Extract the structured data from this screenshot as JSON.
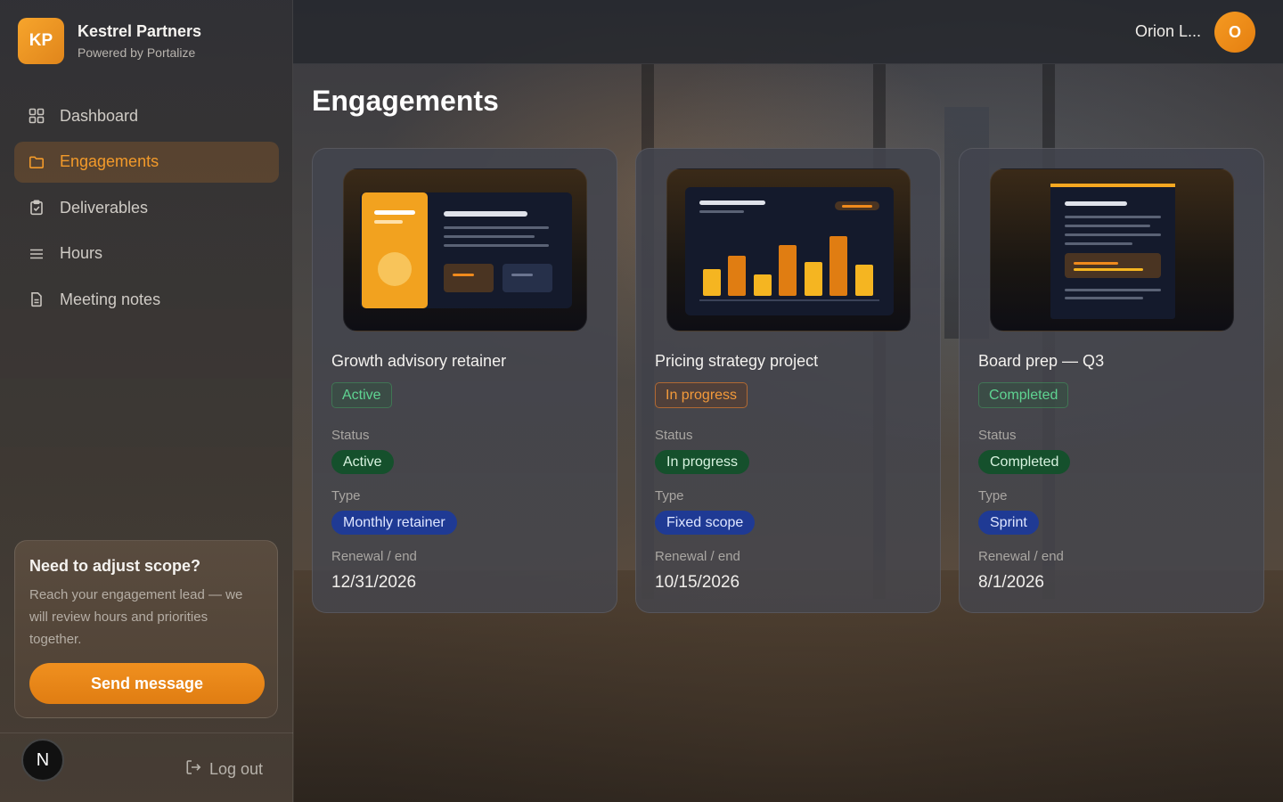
{
  "brand": {
    "logo_text": "KP",
    "name": "Kestrel Partners",
    "subtitle": "Powered by Portalize"
  },
  "nav": {
    "items": [
      {
        "label": "Dashboard",
        "icon": "grid-icon",
        "active": false
      },
      {
        "label": "Engagements",
        "icon": "folder-icon",
        "active": true
      },
      {
        "label": "Deliverables",
        "icon": "clipboard-check-icon",
        "active": false
      },
      {
        "label": "Hours",
        "icon": "menu-lines-icon",
        "active": false
      },
      {
        "label": "Meeting notes",
        "icon": "document-icon",
        "active": false
      }
    ]
  },
  "scope_card": {
    "title": "Need to adjust scope?",
    "text": "Reach your engagement lead — we will review hours and priorities together.",
    "button_label": "Send message"
  },
  "footer": {
    "avatar_letter": "N",
    "logout_label": "Log out"
  },
  "header": {
    "user_name": "Orion L...",
    "user_initial": "O"
  },
  "page_title": "Engagements",
  "labels": {
    "status": "Status",
    "type": "Type",
    "renewal": "Renewal / end"
  },
  "engagements": [
    {
      "title": "Growth advisory retainer",
      "badge": "Active",
      "badge_style": "green",
      "status": "Active",
      "type": "Monthly retainer",
      "renewal": "12/31/2026",
      "thumbnail": "layout-mockup"
    },
    {
      "title": "Pricing strategy project",
      "badge": "In progress",
      "badge_style": "orange",
      "status": "In progress",
      "type": "Fixed scope",
      "renewal": "10/15/2026",
      "thumbnail": "bar-chart-mockup"
    },
    {
      "title": "Board prep — Q3",
      "badge": "Completed",
      "badge_style": "green",
      "status": "Completed",
      "type": "Sprint",
      "renewal": "8/1/2026",
      "thumbnail": "document-mockup"
    }
  ],
  "colors": {
    "accent": "#f0901f",
    "status_green": "#15502c",
    "type_blue": "#1f3a94"
  }
}
